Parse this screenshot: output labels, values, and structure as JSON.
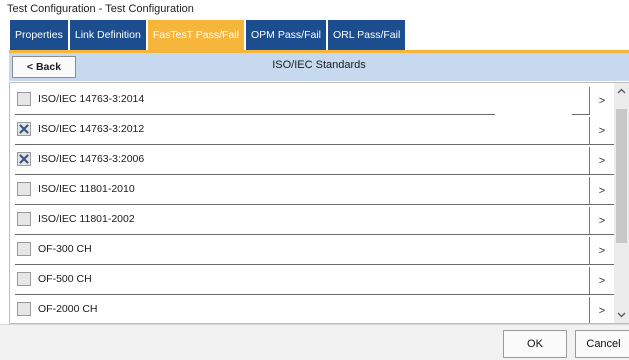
{
  "window": {
    "title": "Test Configuration - Test Configuration"
  },
  "tabs": [
    {
      "label": "Properties",
      "active": false
    },
    {
      "label": "Link Definition",
      "active": false
    },
    {
      "label": "FasTesT Pass/Fail",
      "active": true
    },
    {
      "label": "OPM Pass/Fail",
      "active": false
    },
    {
      "label": "ORL Pass/Fail",
      "active": false
    }
  ],
  "header": {
    "back_label": "< Back",
    "title": "ISO/IEC Standards"
  },
  "standards": [
    {
      "label": "ISO/IEC 14763-3:2014",
      "checked": false,
      "arrow": ">"
    },
    {
      "label": "ISO/IEC 14763-3:2012",
      "checked": true,
      "arrow": ">"
    },
    {
      "label": "ISO/IEC 14763-3:2006",
      "checked": true,
      "arrow": ">"
    },
    {
      "label": "ISO/IEC 11801-2010",
      "checked": false,
      "arrow": ">"
    },
    {
      "label": "ISO/IEC 11801-2002",
      "checked": false,
      "arrow": ">"
    },
    {
      "label": "OF-300 CH",
      "checked": false,
      "arrow": ">"
    },
    {
      "label": "OF-500 CH",
      "checked": false,
      "arrow": ">"
    },
    {
      "label": "OF-2000 CH",
      "checked": false,
      "arrow": ">"
    }
  ],
  "footer": {
    "ok_label": "OK",
    "cancel_label": "Cancel"
  },
  "colors": {
    "tab": "#1c4d8e",
    "tab_active": "#f6b63c",
    "header_bar": "#c6d9ee",
    "check_mark": "#3a5a86"
  },
  "icons": {
    "checkbox_checked": "x-mark-icon",
    "row_arrow": "chevron-right-icon",
    "scroll_up": "chevron-up-icon",
    "scroll_down": "chevron-down-icon"
  }
}
